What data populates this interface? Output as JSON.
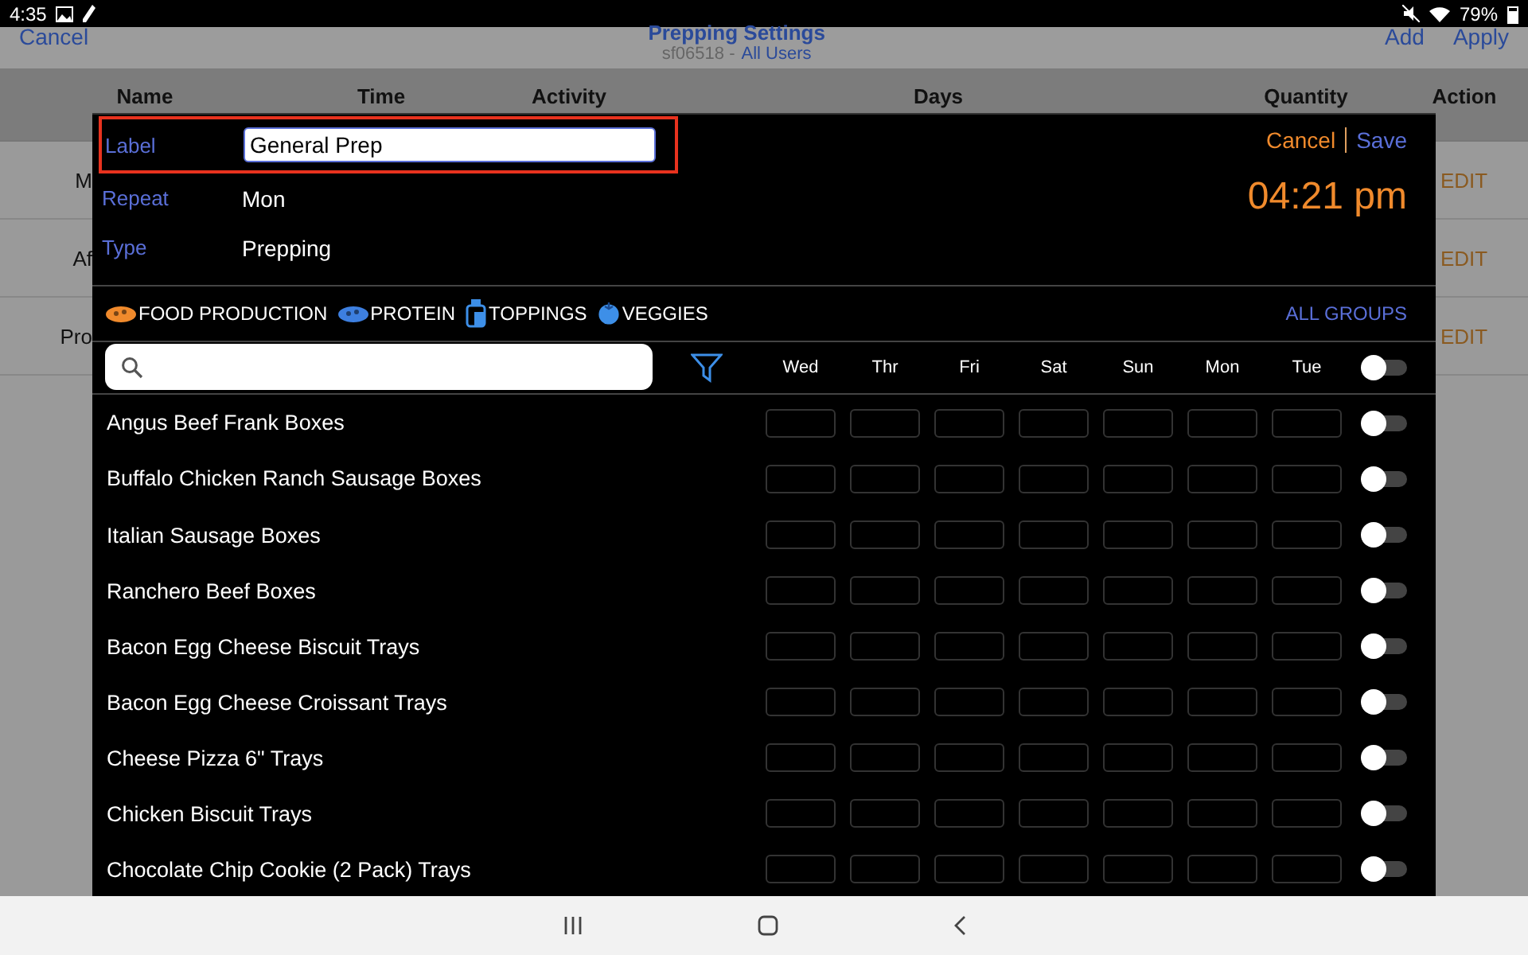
{
  "status_bar": {
    "time": "4:35",
    "battery": "79%"
  },
  "app_header": {
    "cancel": "Cancel",
    "title": "Prepping Settings",
    "store": "sf06518 -",
    "users": "All Users",
    "add": "Add",
    "apply": "Apply"
  },
  "table": {
    "columns": [
      "Name",
      "Time",
      "Activity",
      "Days",
      "Quantity",
      "Action"
    ],
    "rows": [
      {
        "name": "M",
        "action": "EDIT"
      },
      {
        "name": "Af",
        "action": "EDIT"
      },
      {
        "name": "Pro",
        "action": "EDIT"
      }
    ]
  },
  "dialog": {
    "label_caption": "Label",
    "label_value": "General Prep",
    "repeat_caption": "Repeat",
    "repeat_value": "Mon",
    "type_caption": "Type",
    "type_value": "Prepping",
    "cancel": "Cancel",
    "save": "Save",
    "time": "04:21 pm",
    "groups": [
      {
        "kind": "food",
        "label": "FOOD PRODUCTION",
        "color": "#f08a2c"
      },
      {
        "kind": "food",
        "label": "PROTEIN",
        "color": "#3d7fe0"
      },
      {
        "kind": "bottle",
        "label": "TOPPINGS",
        "color": "#3d8fe8"
      },
      {
        "kind": "tomato",
        "label": "VEGGIES",
        "color": "#3d8fe8"
      }
    ],
    "all_groups": "ALL GROUPS",
    "days": [
      "Wed",
      "Thr",
      "Fri",
      "Sat",
      "Sun",
      "Mon",
      "Tue"
    ],
    "all_on": false,
    "items": [
      {
        "name": "Angus Beef Frank Boxes",
        "on": false
      },
      {
        "name": "Buffalo Chicken Ranch Sausage Boxes",
        "on": false
      },
      {
        "name": "Italian Sausage Boxes",
        "on": false
      },
      {
        "name": "Ranchero Beef Boxes",
        "on": false
      },
      {
        "name": "Bacon Egg Cheese Biscuit Trays",
        "on": false
      },
      {
        "name": "Bacon Egg Cheese Croissant Trays",
        "on": false
      },
      {
        "name": "Cheese Pizza 6\" Trays",
        "on": false
      },
      {
        "name": "Chicken Biscuit Trays",
        "on": false
      },
      {
        "name": "Chocolate Chip Cookie (2 Pack) Trays",
        "on": false
      }
    ]
  }
}
